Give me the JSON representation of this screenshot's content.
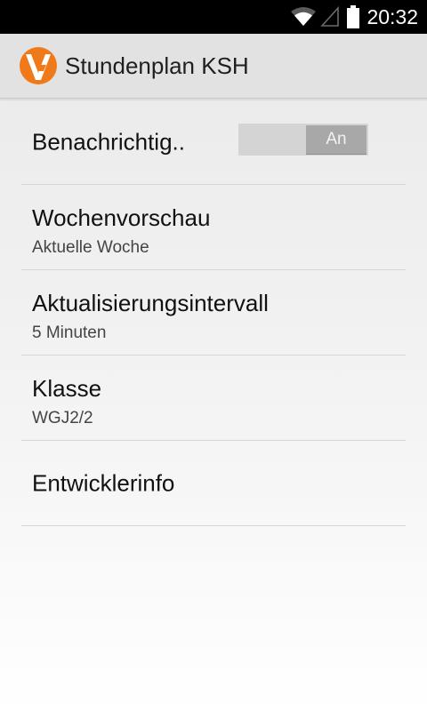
{
  "status_bar": {
    "time": "20:32",
    "icons": [
      "wifi-icon",
      "signal-icon",
      "battery-icon"
    ]
  },
  "action_bar": {
    "title": "Stundenplan KSH",
    "logo": "app-logo-icon",
    "logo_colors": {
      "circle": "#f07a1a",
      "mark": "#ffffff"
    }
  },
  "preferences": {
    "notifications": {
      "title": "Benachrichtig..",
      "switch_label": "An",
      "switch_on": true
    },
    "week_preview": {
      "title": "Wochenvorschau",
      "summary": "Aktuelle Woche"
    },
    "update_interval": {
      "title": "Aktualisierungsintervall",
      "summary": "5 Minuten"
    },
    "class": {
      "title": "Klasse",
      "summary": "WGJ2/2"
    },
    "developer_info": {
      "title": "Entwicklerinfo"
    }
  }
}
